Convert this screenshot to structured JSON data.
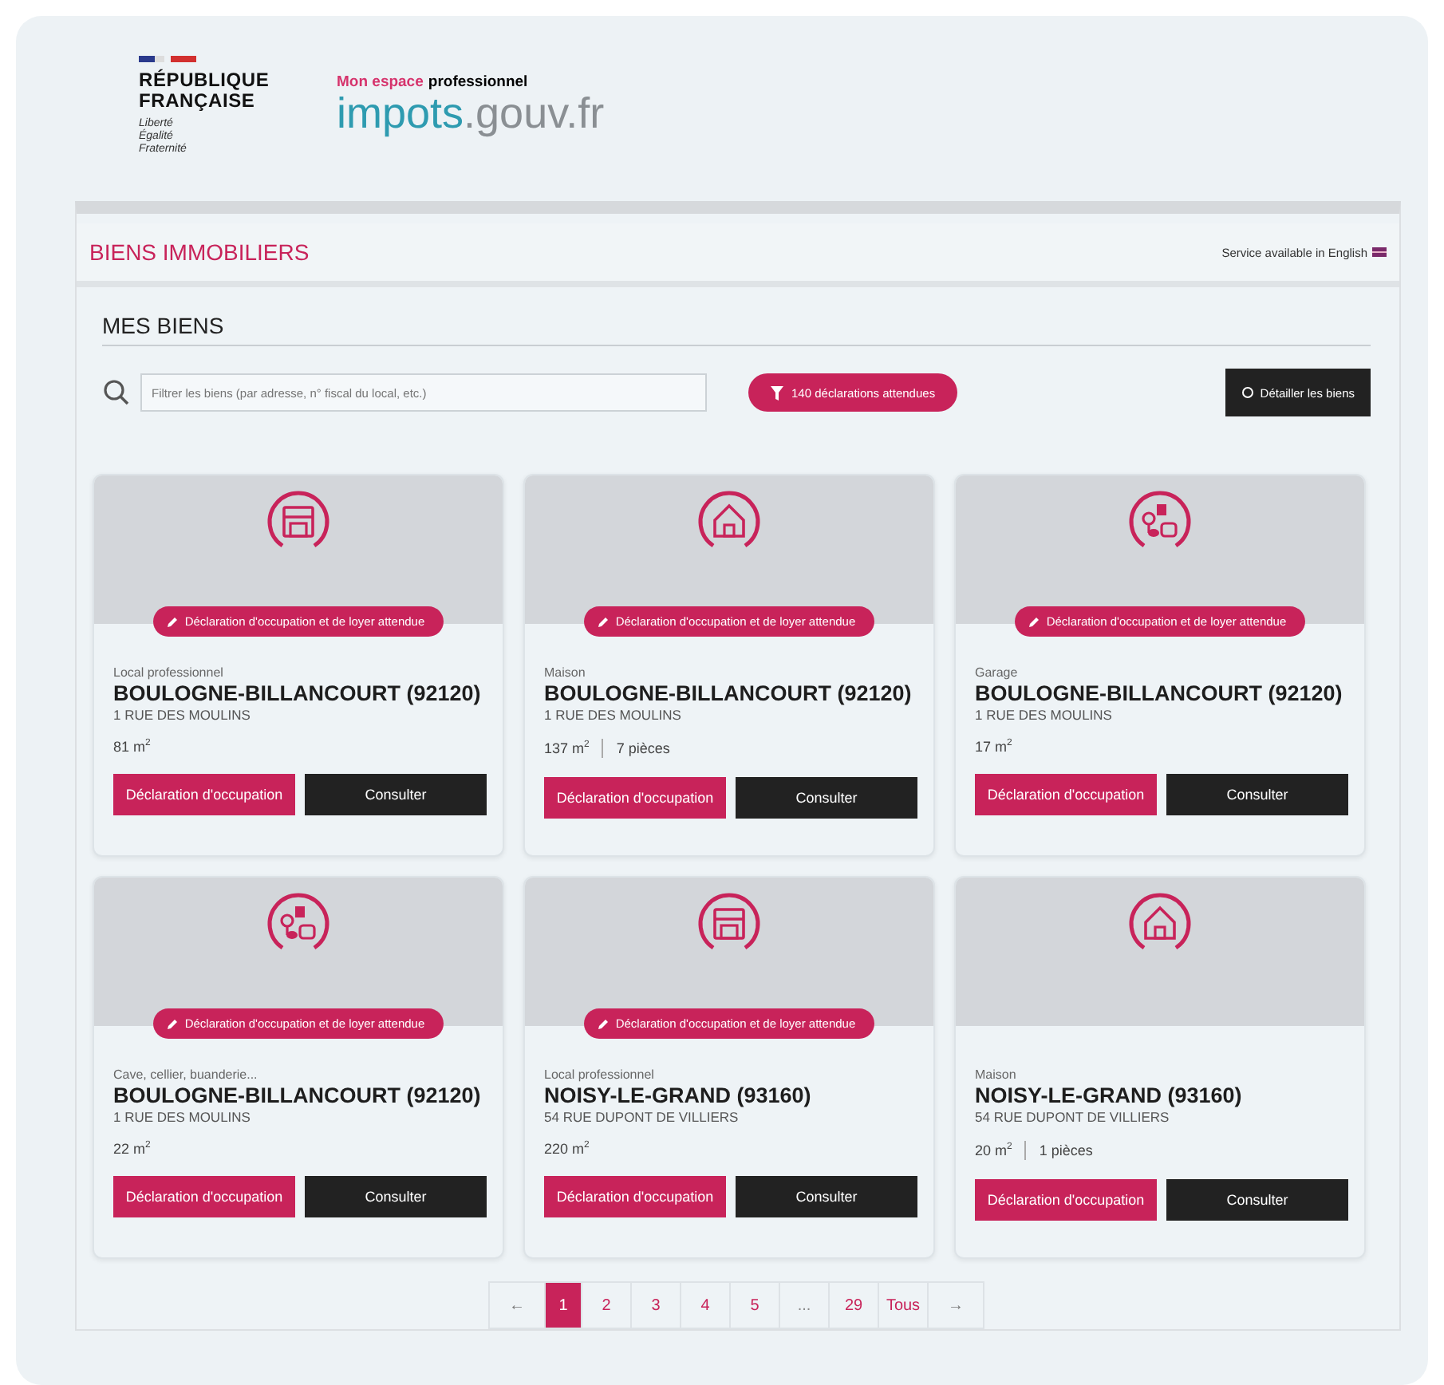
{
  "header": {
    "republic": "RÉPUBLIQUE FRANÇAISE",
    "motto": "Liberté Égalité Fraternité",
    "tagline_accent": "Mon espace",
    "tagline": "professionnel",
    "site_name": "impots",
    "site_domain": ".gouv.fr"
  },
  "page": {
    "title": "BIENS IMMOBILIERS",
    "language_link": "Service available in English"
  },
  "section": {
    "title": "MES BIENS",
    "search": {
      "placeholder": "Filtrer les biens (par adresse, n° fiscal du local, etc.)"
    },
    "filter_button": "140 déclarations attendues",
    "detail_button": "Détailler les biens"
  },
  "properties": [
    {
      "kind": "shop",
      "badge": "Déclaration d'occupation et de loyer attendue",
      "type": "Local professionnel",
      "city": "BOULOGNE-BILLANCOURT (92120)",
      "address": "1 RUE DES MOULINS",
      "area": "81 m$^{2}$",
      "buttons": [
        "Déclaration d'occupation",
        "Consulter"
      ]
    },
    {
      "kind": "house",
      "badge": "Déclaration d'occupation et de loyer attendue",
      "type": "Maison",
      "city": "BOULOGNE-BILLANCOURT (92120)",
      "address": "1 RUE DES MOULINS",
      "area": "137 m$^{2}$",
      "rooms": "7 pièces",
      "buttons": [
        "Déclaration d'occupation",
        "Consulter"
      ]
    },
    {
      "kind": "other",
      "badge": "Déclaration d'occupation et de loyer attendue",
      "type": "Garage",
      "city": "BOULOGNE-BILLANCOURT (92120)",
      "address": "1 RUE DES MOULINS",
      "area": "17 m$^{2}$",
      "buttons": [
        "Déclaration d'occupation",
        "Consulter"
      ]
    },
    {
      "kind": "other",
      "badge": "Déclaration d'occupation et de loyer attendue",
      "type": "Cave, cellier, buanderie...",
      "city": "BOULOGNE-BILLANCOURT (92120)",
      "address": "1 RUE DES MOULINS",
      "area": "22 m$^{2}$",
      "buttons": [
        "Déclaration d'occupation",
        "Consulter"
      ]
    },
    {
      "kind": "shop",
      "badge": "Déclaration d'occupation et de loyer attendue",
      "type": "Local professionnel",
      "city": "NOISY-LE-GRAND (93160)",
      "address": "54 RUE DUPONT DE VILLIERS",
      "area": "220 m$^{2}$",
      "buttons": [
        "Déclaration d'occupation",
        "Consulter"
      ]
    },
    {
      "kind": "house",
      "type": "Maison",
      "city": "NOISY-LE-GRAND (93160)",
      "address": "54 RUE DUPONT DE VILLIERS",
      "area": "20 m$^{2}$",
      "rooms": "1 pièces",
      "buttons": [
        "Déclaration d'occupation",
        "Consulter"
      ]
    }
  ],
  "pagination": [
    {
      "label": "←",
      "kind": "arrow",
      "selected": false
    },
    {
      "label": "1",
      "kind": "page",
      "selected": true
    },
    {
      "label": "2",
      "kind": "page",
      "selected": false
    },
    {
      "label": "3",
      "kind": "page",
      "selected": false
    },
    {
      "label": "4",
      "kind": "page",
      "selected": false
    },
    {
      "label": "5",
      "kind": "page",
      "selected": false
    },
    {
      "label": "...",
      "kind": "gap",
      "selected": false
    },
    {
      "label": "29",
      "kind": "page",
      "selected": false
    },
    {
      "label": "Tous",
      "kind": "page",
      "selected": false
    },
    {
      "label": "→",
      "kind": "arrow",
      "selected": false
    }
  ]
}
